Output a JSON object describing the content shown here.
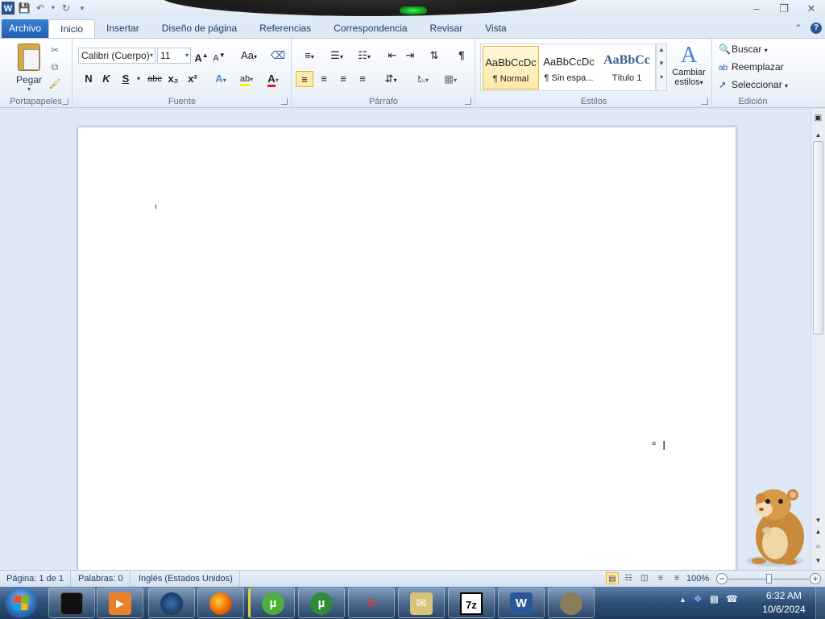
{
  "titlebar": {
    "app_icon_letter": "W",
    "qat": [
      "save-icon",
      "undo-icon",
      "redo-icon",
      "customize-icon"
    ],
    "window_controls": [
      "minimize",
      "restore",
      "close"
    ]
  },
  "tabs": [
    {
      "label": "Archivo",
      "kind": "file"
    },
    {
      "label": "Inicio",
      "kind": "active"
    },
    {
      "label": "Insertar"
    },
    {
      "label": "Diseño de página"
    },
    {
      "label": "Referencias"
    },
    {
      "label": "Correspondencia"
    },
    {
      "label": "Revisar"
    },
    {
      "label": "Vista"
    }
  ],
  "ribbon": {
    "clipboard": {
      "paste_label": "Pegar",
      "group_label": "Portapapeles"
    },
    "font": {
      "font_name": "Calibri (Cuerpo)",
      "font_size": "11",
      "group_label": "Fuente",
      "bold": "N",
      "italic": "K",
      "underline": "S",
      "strike": "abc",
      "sub": "x₂",
      "sup": "x²",
      "grow": "A",
      "shrink": "A",
      "case": "Aa"
    },
    "paragraph": {
      "group_label": "Párrafo",
      "pilcrow": "¶"
    },
    "styles": {
      "group_label": "Estilos",
      "items": [
        {
          "sample": "AaBbCcDc",
          "name": "¶ Normal"
        },
        {
          "sample": "AaBbCcDc",
          "name": "¶ Sin espa..."
        },
        {
          "sample": "AaBbCc",
          "name": "Título 1"
        }
      ],
      "change_label_1": "Cambiar",
      "change_label_2": "estilos"
    },
    "editing": {
      "group_label": "Edición",
      "find": "Buscar",
      "replace": "Reemplazar",
      "select": "Seleccionar"
    }
  },
  "statusbar": {
    "page": "Página: 1 de 1",
    "words": "Palabras: 0",
    "language": "Inglés (Estados Unidos)",
    "zoom": "100%",
    "zoom_level_percent": 100
  },
  "taskbar": {
    "apps": [
      "media-player",
      "firefox",
      "utorrent",
      "utorrent-2",
      "network-manager",
      "mail",
      "7zip",
      "word",
      "gimp"
    ],
    "time": "6:32 AM",
    "date": "10/6/2024"
  },
  "colors": {
    "accent": "#2b5797",
    "file_tab": "#2563b8",
    "taskbar": "#2d4f77"
  }
}
